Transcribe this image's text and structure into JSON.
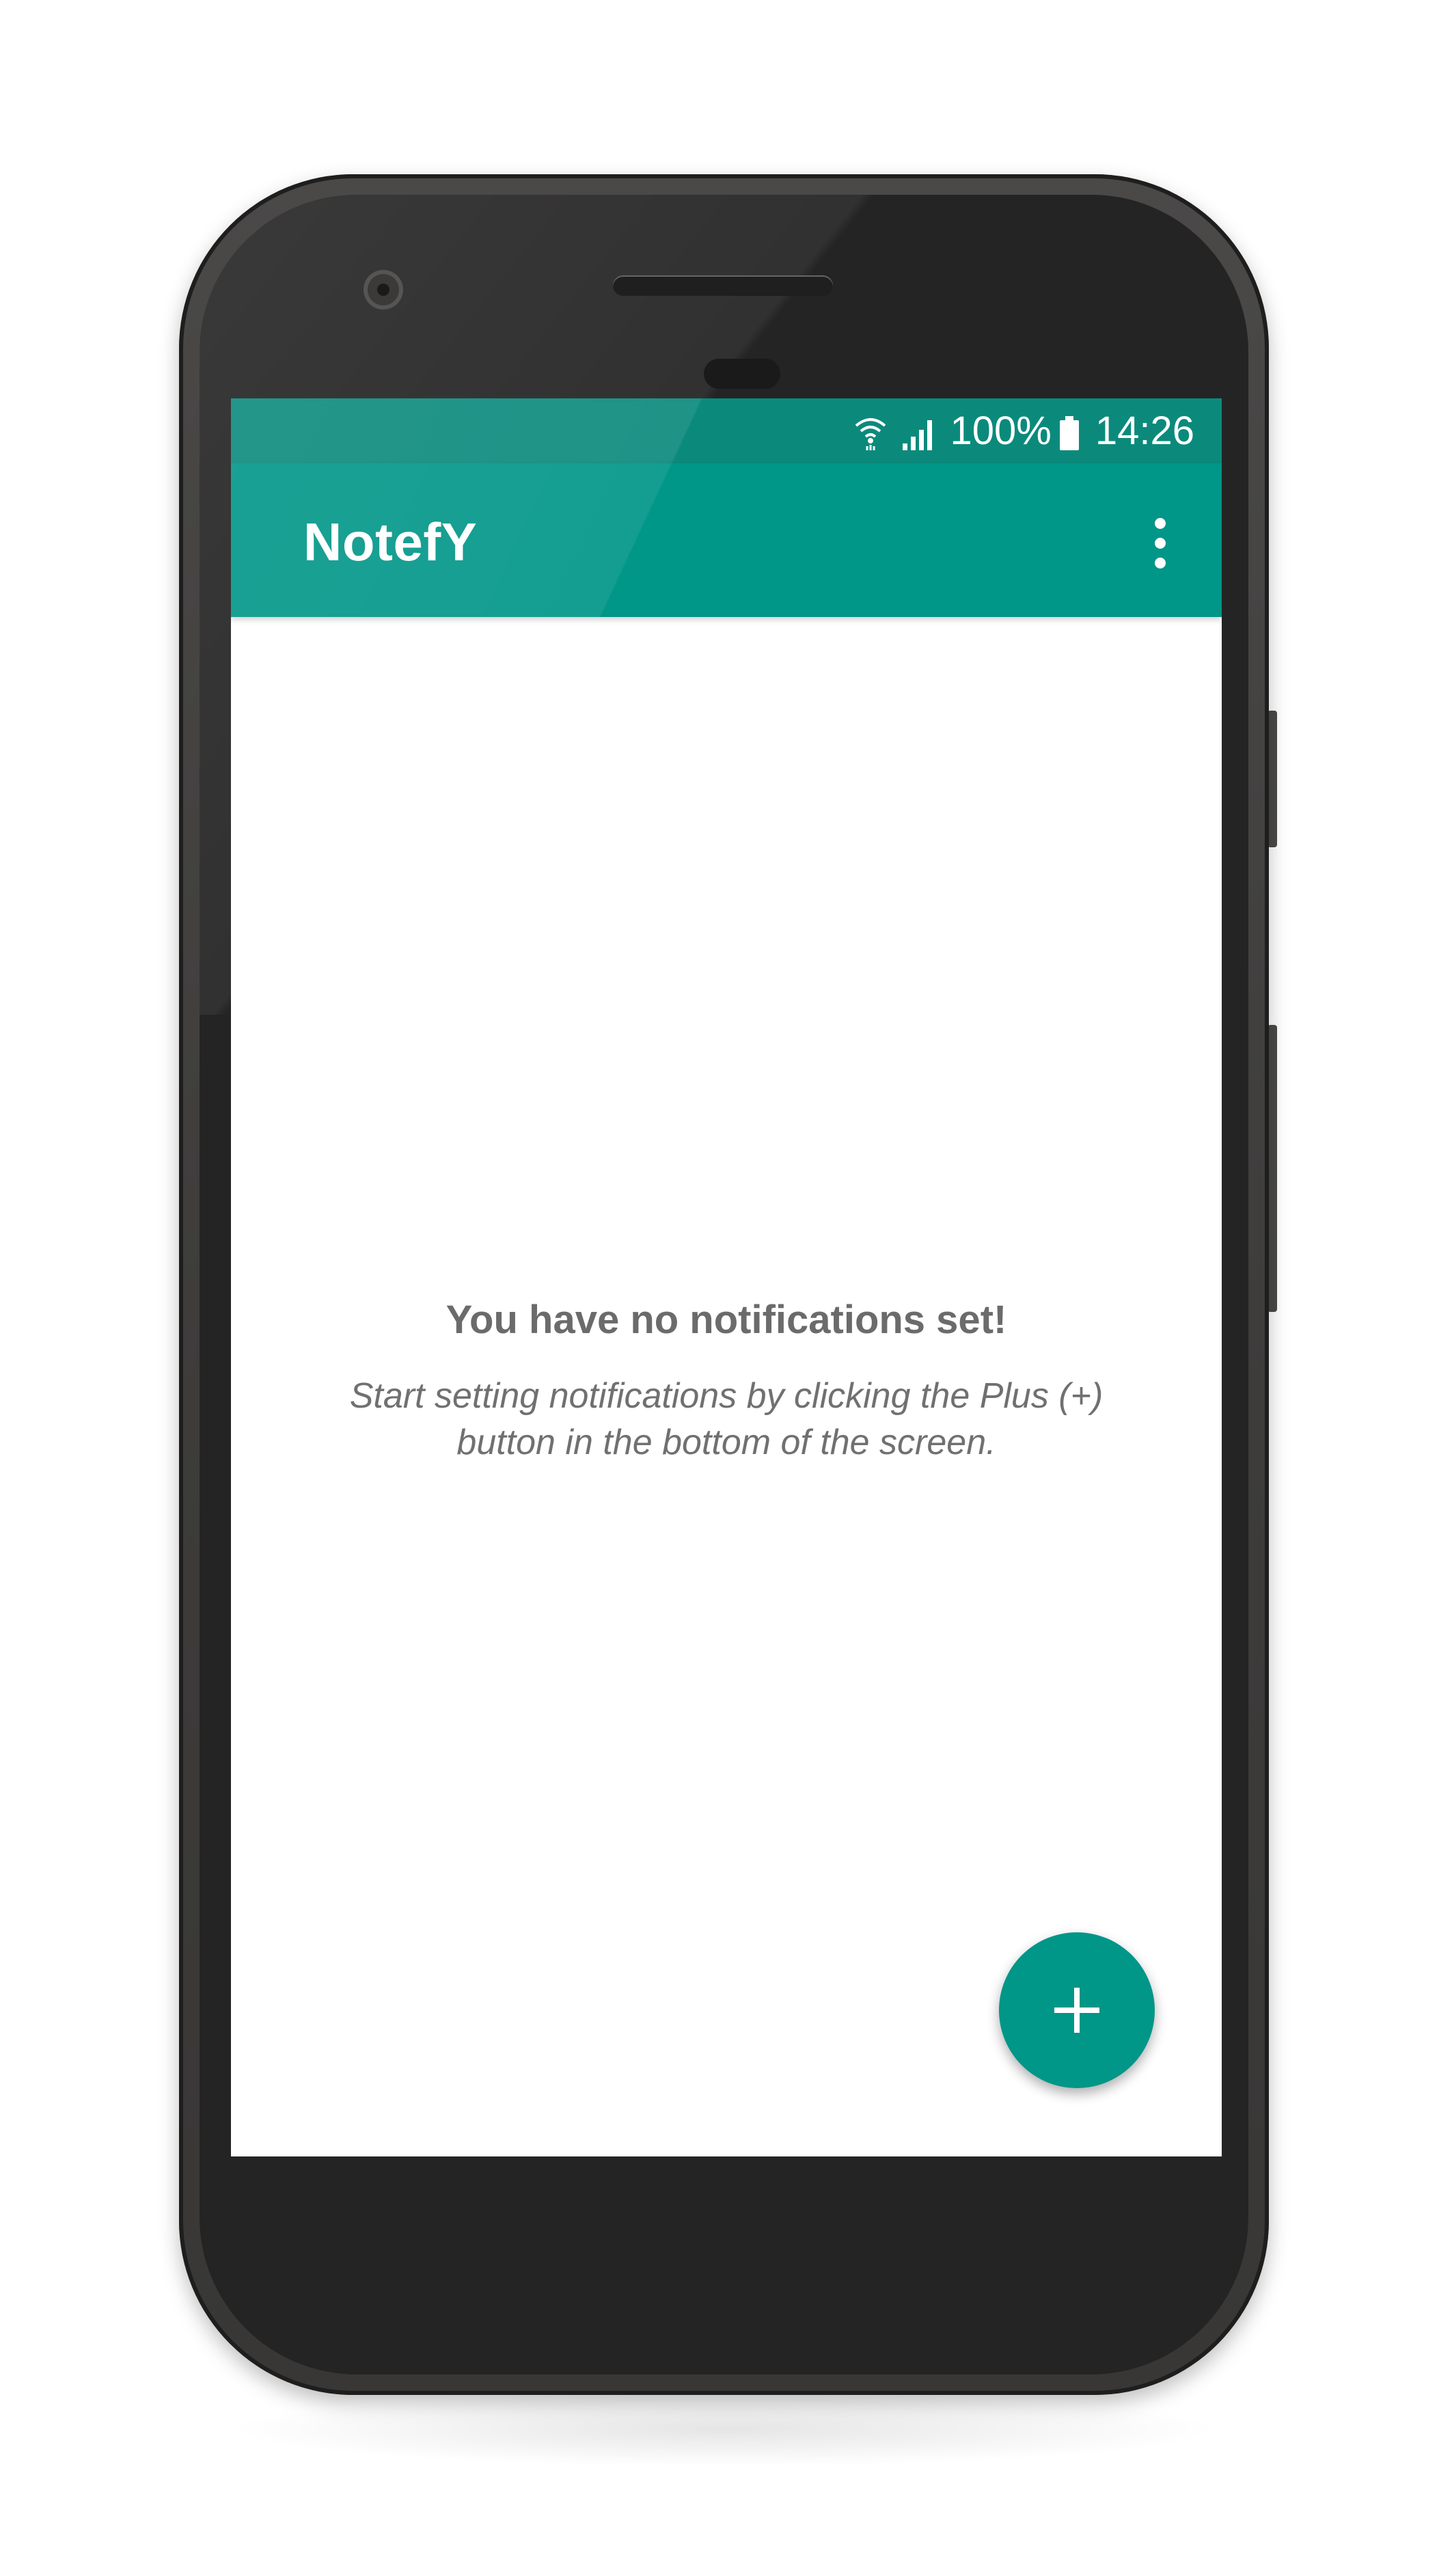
{
  "status_bar": {
    "battery_text": "100%",
    "time": "14:26",
    "icons": [
      "wifi-icon",
      "signal-icon",
      "battery-icon"
    ]
  },
  "app_bar": {
    "title": "NotefY",
    "menu_icon": "more-vert-icon"
  },
  "empty_state": {
    "title": "You have no notifications set!",
    "description": "Start setting notifications by clicking the Plus (+) button in the bottom of the screen."
  },
  "fab": {
    "icon": "plus-icon"
  },
  "colors": {
    "primary": "#009688",
    "primary_dark": "#0b8a7c",
    "background": "#ffffff",
    "text_secondary": "#6b6b6b",
    "device_body": "#3d3c3b"
  }
}
